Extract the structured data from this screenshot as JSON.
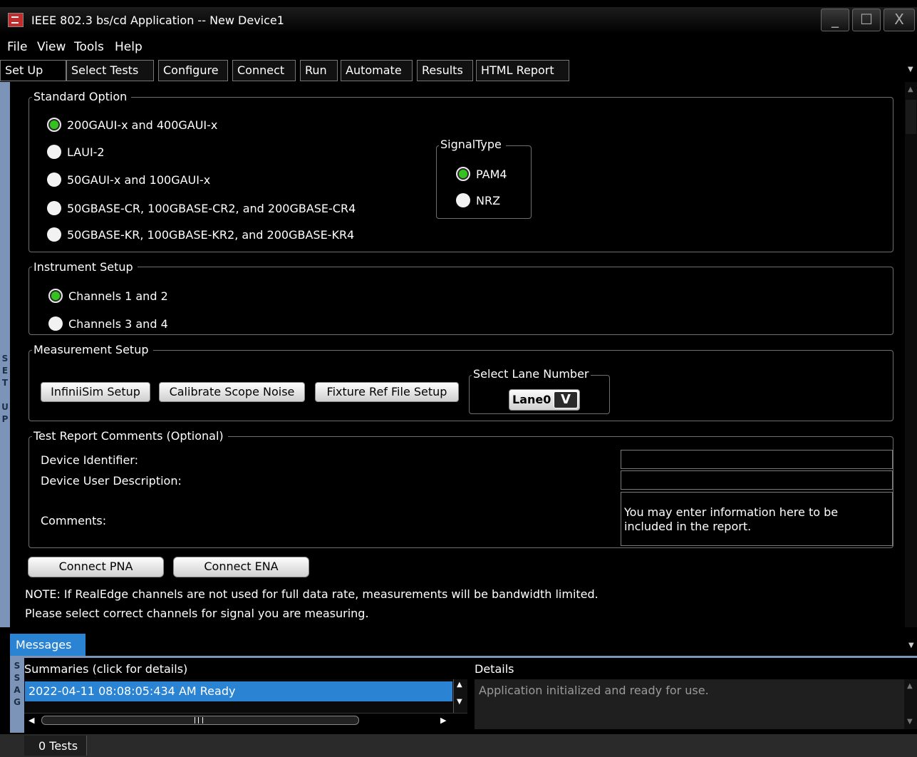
{
  "window": {
    "title": "IEEE 802.3 bs/cd Application -- New Device1",
    "min_glyph": "_",
    "max_glyph": "☐",
    "close_glyph": "X"
  },
  "menu": {
    "items": [
      "File",
      "View",
      "Tools",
      "Help"
    ]
  },
  "tabs": [
    "Set Up",
    "Select Tests",
    "Configure",
    "Connect",
    "Run",
    "Automate",
    "Results",
    "HTML Report"
  ],
  "sidebar": {
    "setup_label": "S E T U P"
  },
  "standard_option": {
    "legend": "Standard Option",
    "options": [
      "200GAUI-x and 400GAUI-x",
      "LAUI-2",
      "50GAUI-x and 100GAUI-x",
      "50GBASE-CR, 100GBASE-CR2, and 200GBASE-CR4",
      "50GBASE-KR, 100GBASE-KR2, and 200GBASE-KR4"
    ],
    "selected": "200GAUI-x and 400GAUI-x"
  },
  "signal_type": {
    "legend": "SignalType",
    "options": [
      "PAM4",
      "NRZ"
    ],
    "selected": "PAM4"
  },
  "instrument_setup": {
    "legend": "Instrument Setup",
    "options": [
      "Channels 1 and 2",
      "Channels 3 and 4"
    ],
    "selected": "Channels 1 and 2"
  },
  "measurement_setup": {
    "legend": "Measurement Setup",
    "buttons": [
      "InfiniiSim Setup",
      "Calibrate Scope Noise",
      "Fixture Ref File Setup"
    ],
    "lane_legend": "Select Lane Number",
    "lane_value": "Lane0"
  },
  "test_report": {
    "legend": "Test Report Comments (Optional)",
    "device_identifier_label": "Device Identifier:",
    "device_identifier_value": "",
    "device_description_label": "Device User Description:",
    "device_description_value": "",
    "comments_label": "Comments:",
    "comments_value": "You may enter information here to be included in the report."
  },
  "connect_buttons": [
    "Connect PNA",
    "Connect ENA"
  ],
  "notes": [
    "NOTE: If RealEdge channels are not used for full data rate, measurements will be bandwidth limited.",
    "Please select correct channels for signal you are measuring."
  ],
  "messages": {
    "tab_label": "Messages",
    "sidebar_label": "S S A G",
    "summaries_header": "Summaries (click for details)",
    "details_header": "Details",
    "summary_rows": [
      "2022-04-11 08:08:05:434 AM Ready"
    ],
    "details_text": "Application initialized and ready for use."
  },
  "status": {
    "tests": "0 Tests"
  },
  "colors": {
    "accent_blue": "#2a83d3",
    "radio_selected_green": "#34c21e",
    "sidebar_blue": "#7c94b8"
  }
}
